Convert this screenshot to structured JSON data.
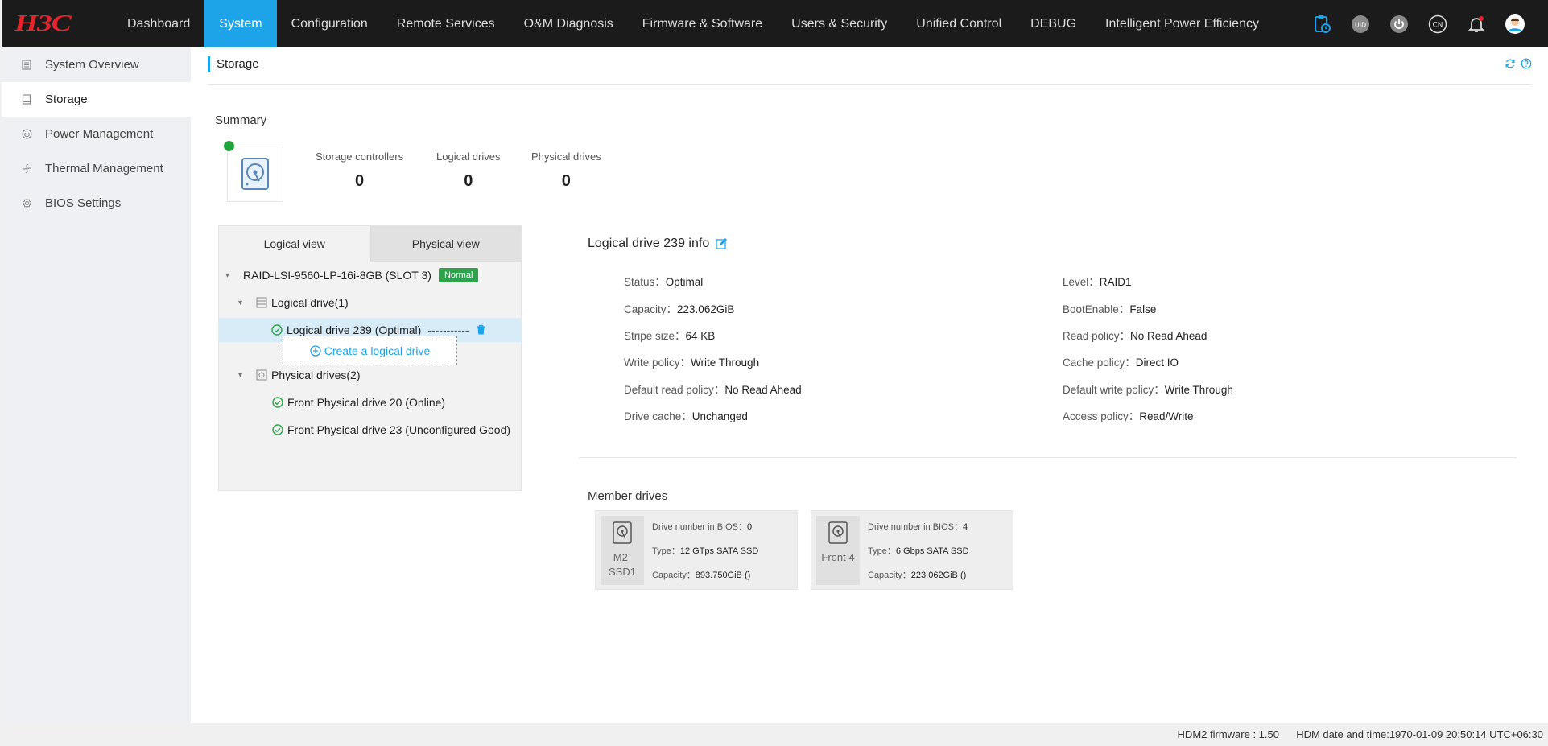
{
  "brand": {
    "logo_text": "H3C"
  },
  "nav": {
    "items": [
      "Dashboard",
      "System",
      "Configuration",
      "Remote Services",
      "O&M Diagnosis",
      "Firmware & Software",
      "Users & Security",
      "Unified Control",
      "DEBUG",
      "Intelligent Power Efficiency"
    ],
    "active_index": 1
  },
  "topbar_icons": {
    "uid_label": "UID",
    "lang_label": "CN"
  },
  "sidebar": {
    "items": [
      {
        "label": "System Overview",
        "icon": "document-icon"
      },
      {
        "label": "Storage",
        "icon": "drive-icon"
      },
      {
        "label": "Power Management",
        "icon": "power-icon"
      },
      {
        "label": "Thermal Management",
        "icon": "fan-icon"
      },
      {
        "label": "BIOS Settings",
        "icon": "gear-icon"
      }
    ],
    "active_index": 1
  },
  "page": {
    "title": "Storage"
  },
  "summary": {
    "title": "Summary",
    "stats": [
      {
        "label": "Storage controllers",
        "value": "0"
      },
      {
        "label": "Logical drives",
        "value": "0"
      },
      {
        "label": "Physical drives",
        "value": "0"
      }
    ]
  },
  "tree": {
    "tabs": [
      "Logical view",
      "Physical view"
    ],
    "controller": {
      "name": "RAID-LSI-9560-LP-16i-8GB (SLOT 3)",
      "status": "Normal"
    },
    "logical_group": "Logical drive(1)",
    "logical_item": {
      "label": "Logical drive 239 (Optimal)",
      "dashes": "-----------"
    },
    "create_label": "Create a logical drive",
    "physical_group": "Physical drives(2)",
    "physical_items": [
      "Front Physical drive 20 (Online)",
      "Front Physical drive 23 (Unconfigured Good)"
    ]
  },
  "info": {
    "title": "Logical drive 239 info",
    "left": [
      {
        "label": "Status",
        "value": "Optimal"
      },
      {
        "label": "Capacity",
        "value": "223.062GiB"
      },
      {
        "label": "Stripe size",
        "value": "64 KB"
      },
      {
        "label": "Write policy",
        "value": "Write Through"
      },
      {
        "label": "Default read policy",
        "value": "No Read Ahead"
      },
      {
        "label": "Drive cache",
        "value": "Unchanged"
      }
    ],
    "right": [
      {
        "label": "Level",
        "value": "RAID1"
      },
      {
        "label": "BootEnable",
        "value": "False"
      },
      {
        "label": "Read policy",
        "value": "No Read Ahead"
      },
      {
        "label": "Cache policy",
        "value": "Direct IO"
      },
      {
        "label": "Default write policy",
        "value": "Write Through"
      },
      {
        "label": "Access policy",
        "value": "Read/Write"
      }
    ]
  },
  "members": {
    "title": "Member drives",
    "labels": {
      "bios": "Drive number in BIOS",
      "type": "Type",
      "capacity": "Capacity"
    },
    "drives": [
      {
        "name_line1": "M2-",
        "name_line2": "SSD1",
        "bios": "0",
        "type": "12 GTps SATA SSD",
        "capacity": "893.750GiB ()"
      },
      {
        "name_line1": "Front 4",
        "name_line2": "",
        "bios": "4",
        "type": "6 Gbps SATA SSD",
        "capacity": "223.062GiB ()"
      }
    ]
  },
  "footer": {
    "firmware_label": "HDM2 firmware : 1.50",
    "datetime_label": "HDM date and time:1970-01-09 20:50:14 UTC+06:30"
  },
  "colors": {
    "accent": "#1ca3e8",
    "topbar": "#1b1b1b",
    "logo": "#e5232a",
    "ok": "#2ea24c"
  }
}
